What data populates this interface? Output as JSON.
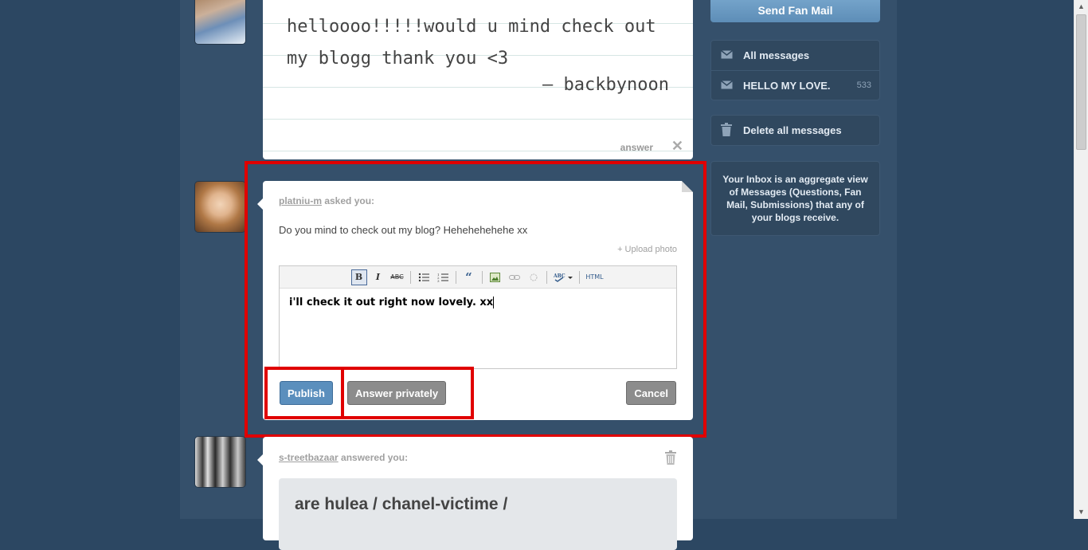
{
  "quote_post": {
    "text": "helloooo!!!!!would u mind check out my blogg thank you <3",
    "source": "— backbynoon",
    "answer_label": "answer",
    "close_glyph": "✕"
  },
  "ask_post": {
    "asker": "platniu-m",
    "asked_suffix": " asked you:",
    "question": "Do you mind to check out my blog? Hehehehehehe xx",
    "upload_label": "+ Upload photo",
    "toolbar": {
      "bold": "B",
      "italic": "I",
      "strike": "ABC",
      "html": "HTML"
    },
    "editor_text": "i'll check it out right now lovely. xx",
    "publish_label": "Publish",
    "private_label": "Answer privately",
    "cancel_label": "Cancel"
  },
  "answer_post": {
    "answerer": "s-treetbazaar",
    "answered_suffix": " answered you:",
    "text": "are hulea / chanel-victime /"
  },
  "sidebar": {
    "send_label": "Send Fan Mail",
    "items": [
      {
        "label": "All messages",
        "icon": "envelope-icon",
        "count": ""
      },
      {
        "label": "HELLO MY LOVE.",
        "icon": "envelope-icon",
        "count": "533"
      }
    ],
    "delete_label": "Delete all messages",
    "info_text": "Your Inbox is an aggregate view of Messages (Questions, Fan Mail, Submissions) that any of your blogs receive."
  },
  "colors": {
    "background": "#2c4762",
    "highlight": "#e00000",
    "publish": "#5b8fbd"
  }
}
